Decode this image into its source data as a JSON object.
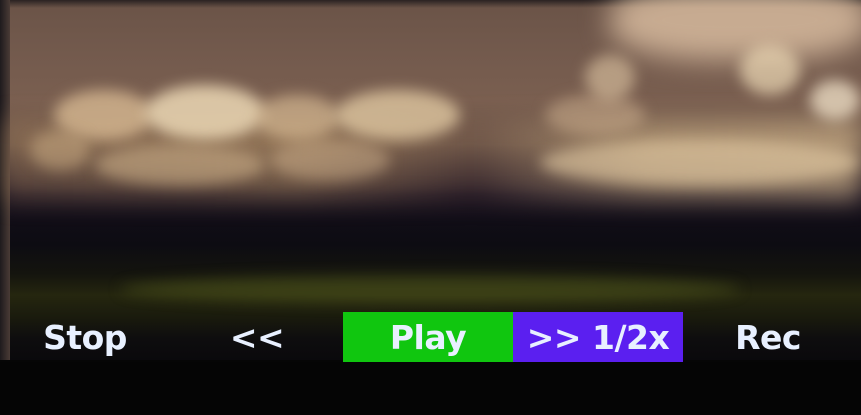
{
  "transport": {
    "stop_label": "Stop",
    "rewind_label": "<<",
    "play_label": "Play",
    "fast_forward_label": ">> 1/2x",
    "record_label": "Rec"
  },
  "colors": {
    "active_play": "#10c60f",
    "active_speed": "#5b1ff0",
    "label_text": "#e8f0ff",
    "background": "#050505"
  },
  "state": {
    "active_mode": "Play",
    "speed": "1/2x"
  }
}
